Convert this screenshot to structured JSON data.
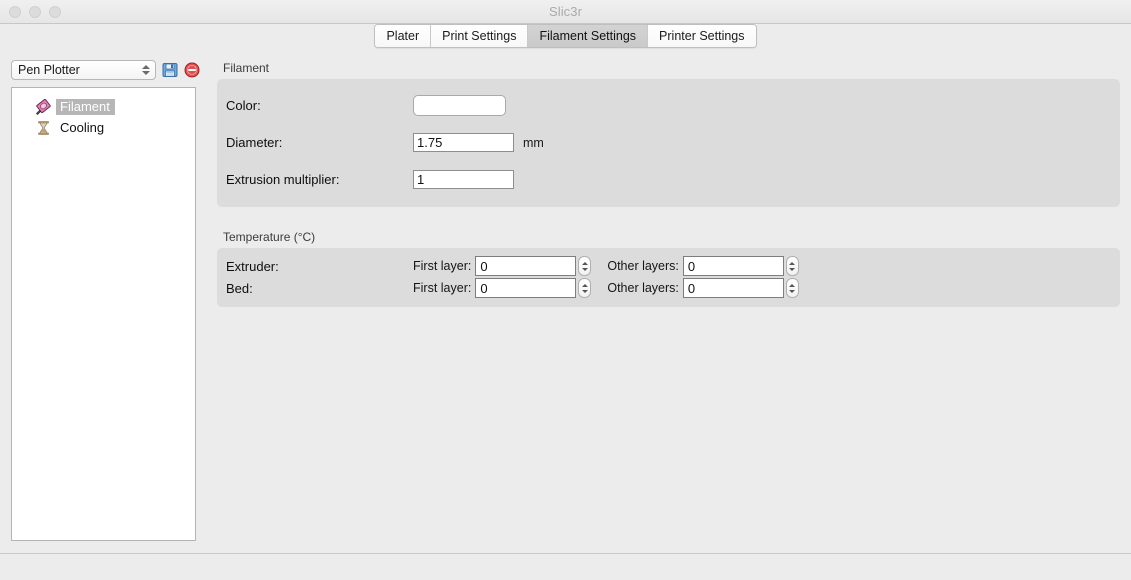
{
  "window": {
    "title": "Slic3r",
    "traffic_lights": [
      "close-button",
      "minimize-button",
      "zoom-button"
    ]
  },
  "tabs": [
    {
      "label": "Plater",
      "active": false
    },
    {
      "label": "Print Settings",
      "active": false
    },
    {
      "label": "Filament Settings",
      "active": true
    },
    {
      "label": "Printer Settings",
      "active": false
    }
  ],
  "sidebar": {
    "preset": {
      "value": "Pen Plotter",
      "save_icon": "floppy-disk-save-icon",
      "delete_icon": "delete-preset-icon"
    },
    "tree": [
      {
        "label": "Filament",
        "icon": "filament-spool-icon",
        "selected": true
      },
      {
        "label": "Cooling",
        "icon": "hourglass-cooling-icon",
        "selected": false
      }
    ]
  },
  "main": {
    "filament_group": {
      "title": "Filament",
      "color": {
        "label": "Color:",
        "value": "#ffffff"
      },
      "diameter": {
        "label": "Diameter:",
        "value": "1.75",
        "unit": "mm"
      },
      "extrusion_multiplier": {
        "label": "Extrusion multiplier:",
        "value": "1"
      }
    },
    "temperature_group": {
      "title": "Temperature (°C)",
      "rows": [
        {
          "label": "Extruder:",
          "first_layer_label": "First layer:",
          "first_layer_value": "0",
          "other_layers_label": "Other layers:",
          "other_layers_value": "0"
        },
        {
          "label": "Bed:",
          "first_layer_label": "First layer:",
          "first_layer_value": "0",
          "other_layers_label": "Other layers:",
          "other_layers_value": "0"
        }
      ]
    }
  },
  "statusbar": {
    "text": ""
  },
  "colors": {
    "window_bg": "#ececec",
    "group_bg": "#dcdcdc",
    "selection": "#b6b6b6",
    "title_text": "#aaaaaa"
  }
}
